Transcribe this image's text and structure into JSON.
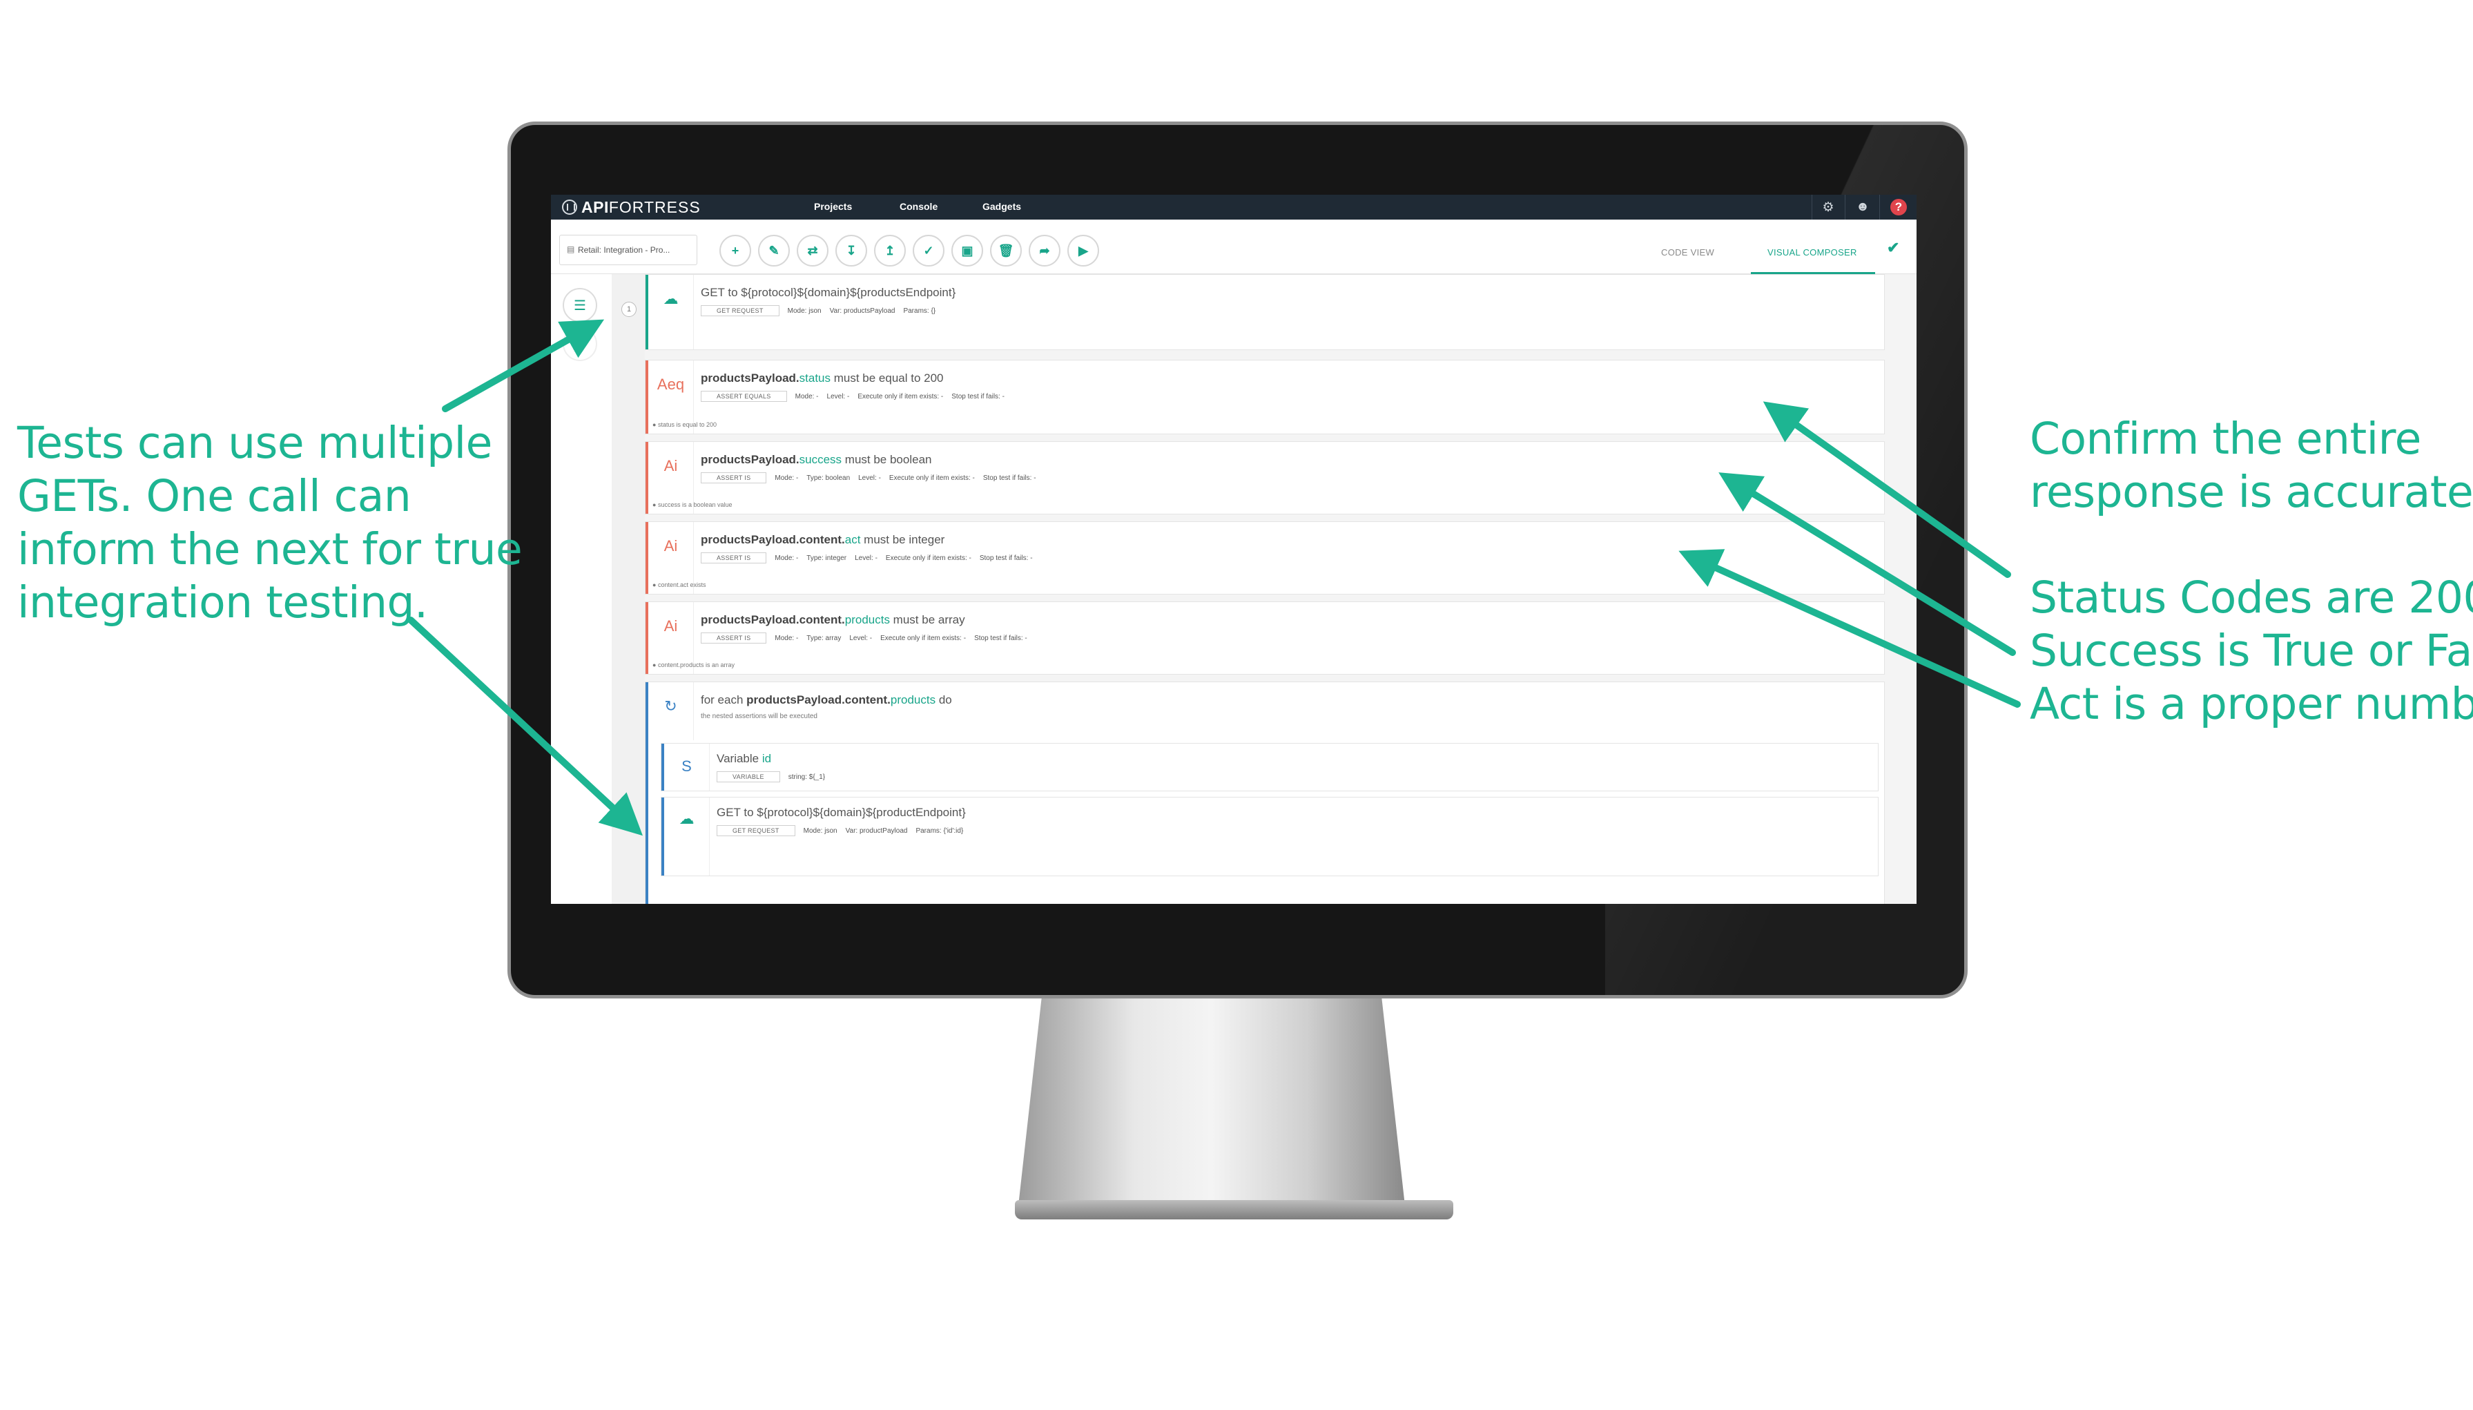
{
  "annotations": {
    "left_lines": [
      "Tests can use multiple",
      "GETs. One call can",
      "inform the next for true",
      "integration testing."
    ],
    "right_top_lines": [
      "Confirm the entire",
      "response is accurate."
    ],
    "right_bottom_lines": [
      "Status Codes are 200",
      "Success is True or False",
      "Act is a proper number"
    ],
    "color": "#1db592"
  },
  "app": {
    "logo_api": "API",
    "logo_fortress": "FORTRESS",
    "nav": [
      "Projects",
      "Console",
      "Gadgets"
    ],
    "accent_color": "#19a58a",
    "topbar_color": "#1f2a35"
  },
  "toolbar": {
    "file_tab": "Retail: Integration - Pro...",
    "tools": [
      "add-icon",
      "edit-icon",
      "swap-icon",
      "download-icon",
      "upload-icon",
      "check-icon",
      "save-icon",
      "delete-icon",
      "export-icon",
      "run-icon"
    ],
    "code_view": "CODE VIEW",
    "visual_composer": "VISUAL COMPOSER"
  },
  "steps": {
    "get1": {
      "prefix": "GET to ",
      "target": "${protocol}${domain}${productsEndpoint}",
      "tag": "GET REQUEST",
      "mode": "Mode: json",
      "var": "Var: productsPayload",
      "params": "Params: {}"
    },
    "a1": {
      "badge": "Aeq",
      "subject": "productsPayload.",
      "field": "status",
      "rest": " must be equal to 200",
      "tag": "ASSERT EQUALS",
      "meta": [
        "Mode: -",
        "Level: -",
        "Execute only if item exists: -",
        "Stop test if fails: -"
      ],
      "note": "status is equal to 200"
    },
    "a2": {
      "badge": "Ai",
      "subject": "productsPayload.",
      "field": "success",
      "rest": " must be boolean",
      "tag": "ASSERT IS",
      "meta": [
        "Mode: -",
        "Type: boolean",
        "Level: -",
        "Execute only if item exists: -",
        "Stop test if fails: -"
      ],
      "note": "success is a boolean value"
    },
    "a3": {
      "badge": "Ai",
      "subject": "productsPayload.content.",
      "field": "act",
      "rest": " must be integer",
      "tag": "ASSERT IS",
      "meta": [
        "Mode: -",
        "Type: integer",
        "Level: -",
        "Execute only if item exists: -",
        "Stop test if fails: -"
      ],
      "note": "content.act exists"
    },
    "a4": {
      "badge": "Ai",
      "subject": "productsPayload.content.",
      "field": "products",
      "rest": " must be array",
      "tag": "ASSERT IS",
      "meta": [
        "Mode: -",
        "Type: array",
        "Level: -",
        "Execute only if item exists: -",
        "Stop test if fails: -"
      ],
      "note": "content.products is an array"
    },
    "each": {
      "prefix": "for each ",
      "subject": "productsPayload.content.",
      "field": "products",
      "rest": " do",
      "sub": "the nested assertions will be executed"
    },
    "var": {
      "badge": "S",
      "prefix": "Variable ",
      "field": "id",
      "tag": "VARIABLE",
      "meta": "string: ${_1}"
    },
    "get2": {
      "prefix": "GET to ",
      "target": "${protocol}${domain}${productEndpoint}",
      "tag": "GET REQUEST",
      "mode": "Mode: json",
      "var": "Var: productPayload",
      "params": "Params: {'id':id}"
    }
  }
}
